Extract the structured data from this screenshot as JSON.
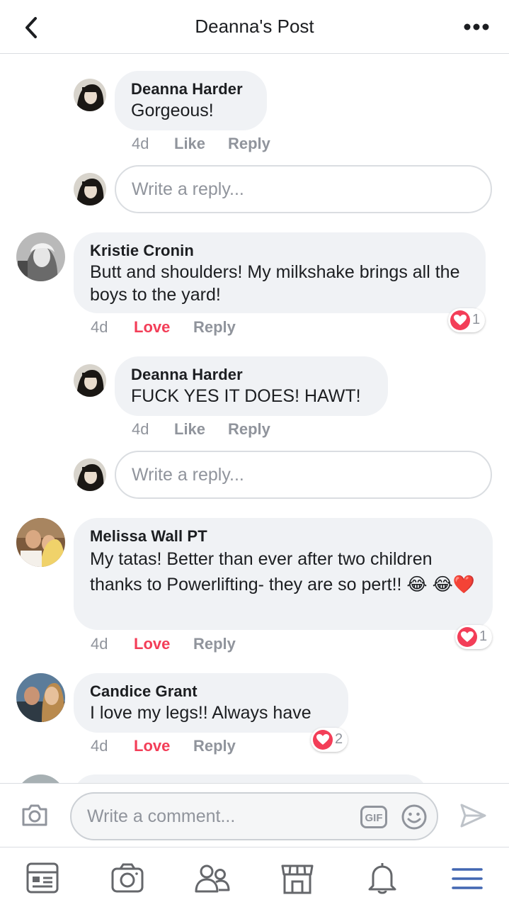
{
  "header": {
    "title": "Deanna's Post",
    "back_icon": "chevron-left-icon",
    "more_icon": "more-horizontal-icon"
  },
  "comments": [
    {
      "author": "Deanna Harder",
      "text": "Gorgeous!",
      "time": "4d",
      "reaction_label": "Like",
      "reply_label": "Reply"
    },
    {
      "author": "Kristie Cronin",
      "text": "Butt and shoulders! My milkshake brings all the boys to the yard!",
      "time": "4d",
      "reaction_label": "Love",
      "reply_label": "Reply",
      "reaction_count": "1"
    },
    {
      "author": "Deanna Harder",
      "text": "FUCK YES IT DOES! HAWT!",
      "time": "4d",
      "reaction_label": "Like",
      "reply_label": "Reply"
    },
    {
      "author": "Melissa Wall PT",
      "text": "My tatas! Better than ever after two children thanks to Powerlifting- they are so pert!! 😂 😂❤️",
      "time": "4d",
      "reaction_label": "Love",
      "reply_label": "Reply",
      "reaction_count": "1"
    },
    {
      "author": "Candice Grant",
      "text": "I love my legs!! Always have",
      "time": "4d",
      "reaction_label": "Love",
      "reply_label": "Reply",
      "reaction_count": "2"
    }
  ],
  "reply_inputs": [
    {
      "placeholder": "Write a reply..."
    },
    {
      "placeholder": "Write a reply..."
    }
  ],
  "composer": {
    "placeholder": "Write a comment...",
    "gif_label": "GIF"
  },
  "bottom_nav": [
    "news-feed-icon",
    "camera-icon",
    "friends-icon",
    "marketplace-icon",
    "notifications-icon",
    "menu-icon"
  ],
  "colors": {
    "love": "#f33e58",
    "accent": "#4267b2",
    "meta": "#90949c",
    "bubble": "#f0f2f5"
  }
}
